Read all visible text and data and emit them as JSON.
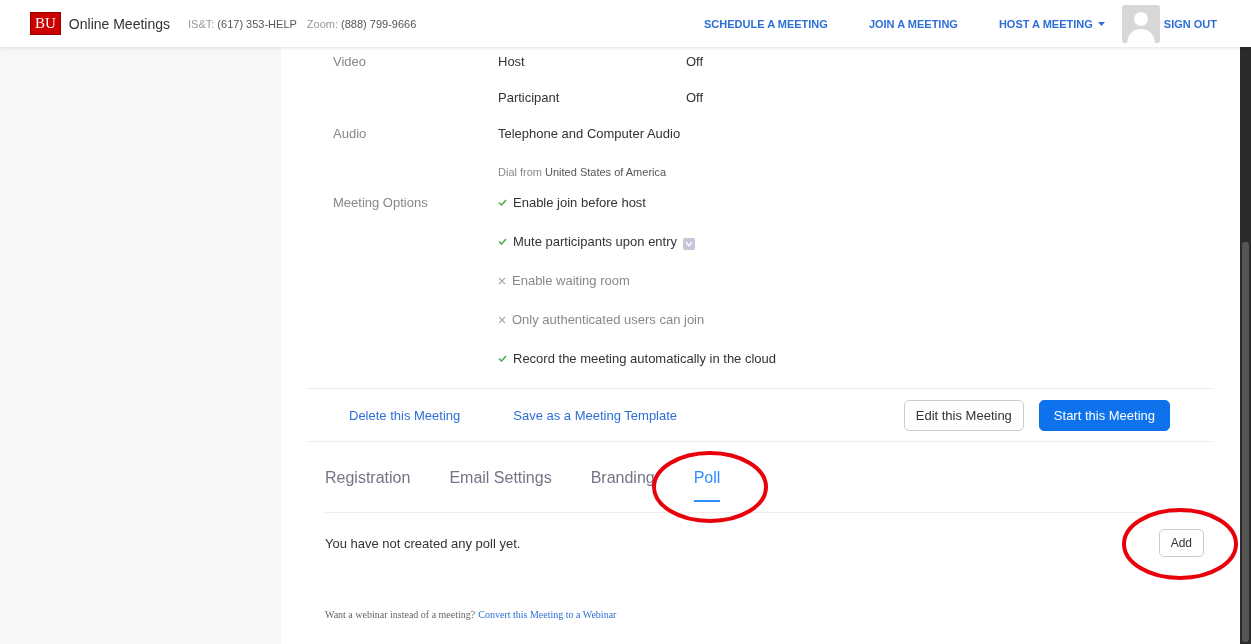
{
  "header": {
    "logo": "BU",
    "title": "Online Meetings",
    "contacts": [
      {
        "label": "IS&T:",
        "value": "(617) 353-HELP"
      },
      {
        "label": "Zoom:",
        "value": "(888) 799-9666"
      }
    ],
    "nav": [
      {
        "label": "SCHEDULE A MEETING",
        "dropdown": false
      },
      {
        "label": "JOIN A MEETING",
        "dropdown": false
      },
      {
        "label": "HOST A MEETING",
        "dropdown": true
      }
    ],
    "sign_out": "SIGN OUT"
  },
  "settings": [
    {
      "label": "Video",
      "values": [
        {
          "name": "Host",
          "value": "Off"
        },
        {
          "name": "Participant",
          "value": "Off"
        }
      ]
    },
    {
      "label": "Audio",
      "values": [
        {
          "name": "Telephone and Computer Audio"
        }
      ],
      "note": {
        "prefix": "Dial from",
        "value": "United States of America"
      }
    }
  ],
  "meeting_options": {
    "label": "Meeting Options",
    "items": [
      {
        "text": "Enable join before host",
        "checked": true,
        "badge": false
      },
      {
        "text": "Mute participants upon entry",
        "checked": true,
        "badge": true
      },
      {
        "text": "Enable waiting room",
        "checked": false,
        "badge": false
      },
      {
        "text": "Only authenticated users can join",
        "checked": false,
        "badge": false
      },
      {
        "text": "Record the meeting automatically in the cloud",
        "checked": true,
        "badge": false
      }
    ]
  },
  "actions": {
    "links": [
      "Delete this Meeting",
      "Save as a Meeting Template"
    ],
    "buttons": [
      {
        "label": "Edit this Meeting",
        "kind": "secondary"
      },
      {
        "label": "Start this Meeting",
        "kind": "primary"
      }
    ]
  },
  "tabs": [
    {
      "label": "Registration",
      "selected": false,
      "highlighted": false
    },
    {
      "label": "Email Settings",
      "selected": false,
      "highlighted": false
    },
    {
      "label": "Branding",
      "selected": false,
      "highlighted": false
    },
    {
      "label": "Poll",
      "selected": true,
      "highlighted": true
    }
  ],
  "poll": {
    "message": "You have not created any poll yet.",
    "add_button": {
      "label": "Add",
      "highlighted": true
    }
  },
  "footer": {
    "text": "Want a webinar instead of a meeting?",
    "link": "Convert this Meeting to a Webinar"
  }
}
